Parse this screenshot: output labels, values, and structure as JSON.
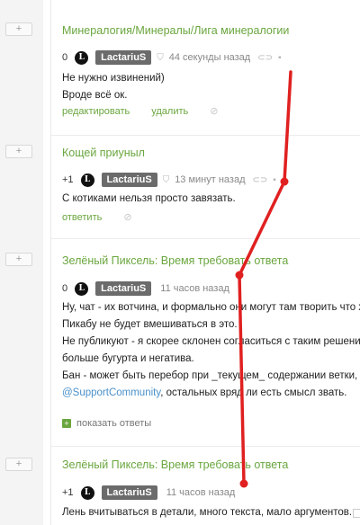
{
  "expand_glyph": "+",
  "comments": [
    {
      "post_title": "Минералогия/Минералы/Лига минералогии",
      "score": "0",
      "avatar_letter": "L",
      "nick": "LactariuS",
      "time": "44 секунды назад",
      "lines": [
        "Не нужно извинений)",
        "Вроде всё ок."
      ],
      "actions": [
        "редактировать",
        "удалить"
      ]
    },
    {
      "post_title": "Кощей приуныл",
      "score": "+1",
      "avatar_letter": "L",
      "nick": "LactariuS",
      "time": "13 минут назад",
      "lines": [
        "С котиками нельзя просто завязать."
      ],
      "actions": [
        "ответить"
      ]
    },
    {
      "post_title": "Зелёный Пиксель: Время требовать ответа",
      "score": "0",
      "avatar_letter": "L",
      "nick": "LactariuS",
      "time": "11 часов назад",
      "lines": [
        "Ну, чат - их вотчина, и формально они могут там творить что х",
        "Пикабу не будет вмешиваться в это.",
        "Не публикуют - я скорее склонен согласиться с таким решение",
        "больше бугурта и негатива.",
        "Бан - может быть перебор при _текущем_ содержании ветки, н"
      ],
      "mention": "@SupportCommunity",
      "mention_tail": ", остальных вряд ли есть смысл звать.",
      "show_replies": "показать ответы"
    },
    {
      "post_title": "Зелёный Пиксель: Время требовать ответа",
      "score": "+1",
      "avatar_letter": "L",
      "nick": "LactariuS",
      "time": "11 часов назад",
      "lines": [
        "Лень вчитываться в детали, много текста, мало аргументов."
      ]
    }
  ],
  "overlay_color": "#e02020"
}
